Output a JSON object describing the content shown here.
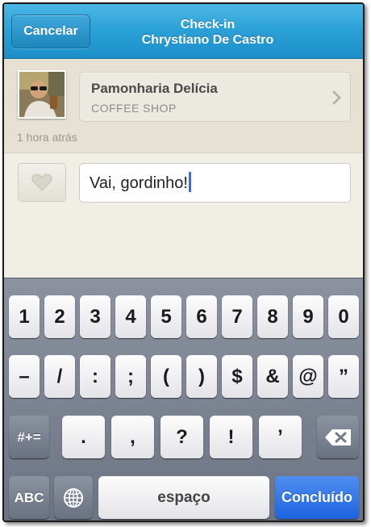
{
  "navbar": {
    "cancel_label": "Cancelar",
    "title_line1": "Check-in",
    "title_line2": "Chrystiano De Castro"
  },
  "venue": {
    "name": "Pamonharia Delícia",
    "category": "COFFEE SHOP",
    "time_ago": "1 hora atrás"
  },
  "compose": {
    "text": "Vai, gordinho!"
  },
  "keyboard": {
    "row1": [
      "1",
      "2",
      "3",
      "4",
      "5",
      "6",
      "7",
      "8",
      "9",
      "0"
    ],
    "row2": [
      "–",
      "/",
      ":",
      ";",
      "(",
      ")",
      "$",
      "&",
      "@",
      "”"
    ],
    "row3": [
      "#+=",
      ".",
      ",",
      "?",
      "!",
      "’"
    ],
    "row4": [
      "ABC",
      "espaço",
      "Concluído"
    ]
  },
  "icons": {
    "venue_chevron": "chevron-right-icon",
    "like": "heart-icon",
    "backspace": "backspace-icon",
    "globe": "globe-icon"
  },
  "colors": {
    "navbar": "#2aa0d6",
    "done_key": "#1e63e0",
    "caret": "#3a6fe0"
  }
}
